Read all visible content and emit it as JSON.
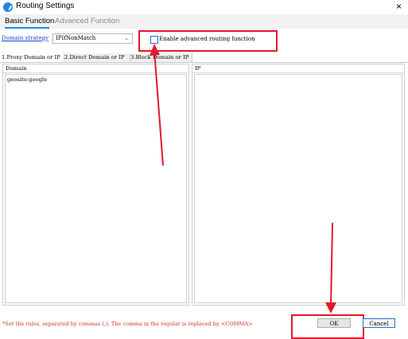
{
  "window": {
    "title": "Routing Settings",
    "close": "×"
  },
  "tabs": [
    "Basic Function",
    "Advanced Function"
  ],
  "routing": {
    "strategy_label": "Domain strategy",
    "strategy_value": "IPIfNonMatch",
    "advanced_checkbox_label": "Enable advanced routing function"
  },
  "subtabs": [
    "1.Proxy Domain or IP",
    "2.Direct Domain or IP",
    "3.Block Domain or IP"
  ],
  "panels": {
    "domain_header": "Domain",
    "ip_header": "IP",
    "domain_text": "geosite:google",
    "ip_text": ""
  },
  "footer": {
    "hint": "*Set the rules, separated by commas (,); The comma in the regular is replaced by <COMMA>",
    "ok": "OK",
    "cancel": "Cancel"
  },
  "colors": {
    "accent": "#1e88e5",
    "annotation_red": "#e3182c",
    "hint_red": "#d32f2f"
  }
}
